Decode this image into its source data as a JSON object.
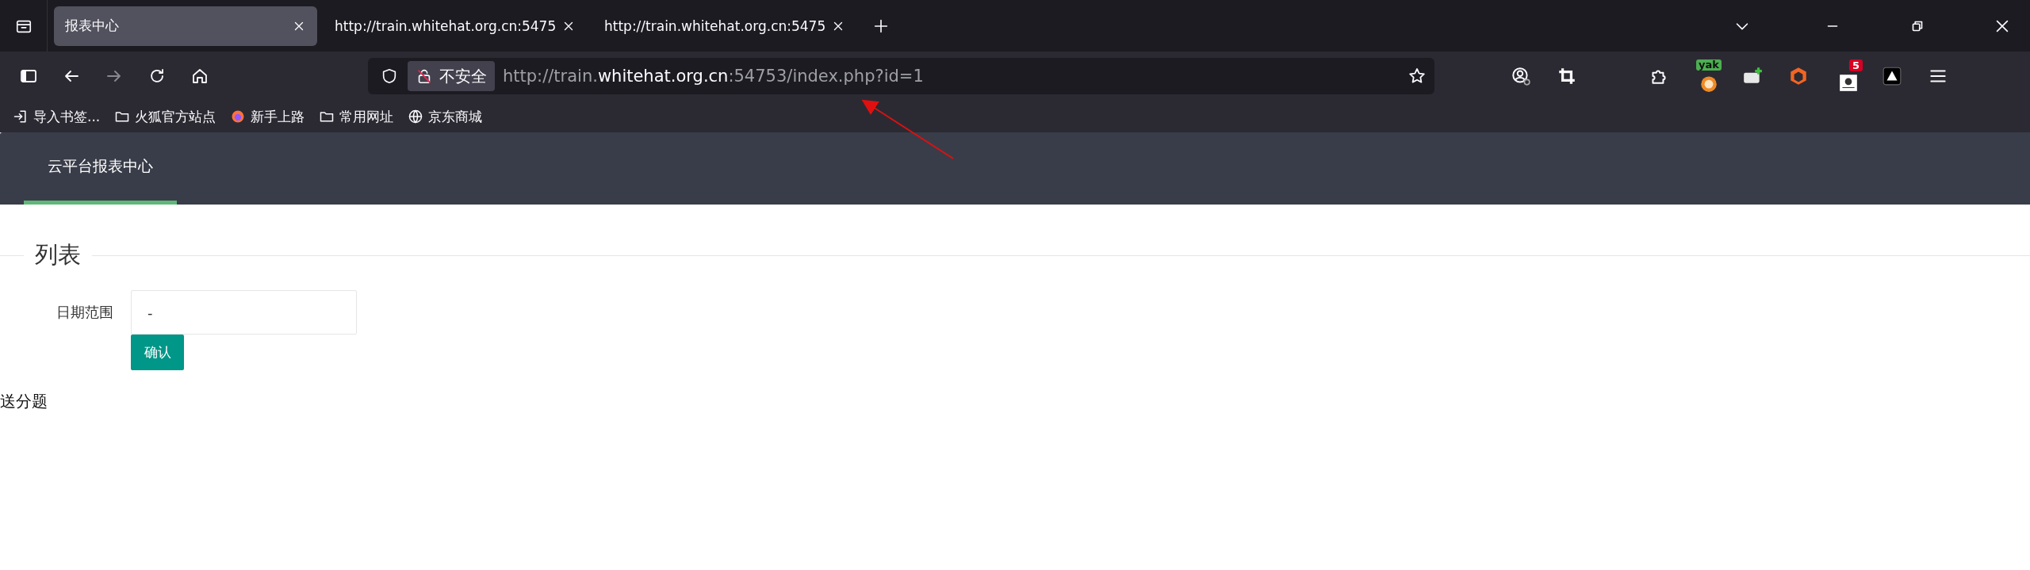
{
  "browser": {
    "tabs": [
      {
        "title": "报表中心",
        "selected": true
      },
      {
        "title": "http://train.whitehat.org.cn:5475",
        "selected": false
      },
      {
        "title": "http://train.whitehat.org.cn:5475",
        "selected": false
      }
    ],
    "security_label": "不安全",
    "url_parts": [
      {
        "text": "http://train.",
        "emphasized": false
      },
      {
        "text": "whitehat.org.cn",
        "emphasized": true
      },
      {
        "text": ":54753/index.php?id=1",
        "emphasized": false
      }
    ],
    "extension_tag": "yak",
    "notification_count": "5",
    "bookmarks": [
      {
        "label": "导入书签...",
        "kind": "import"
      },
      {
        "label": "火狐官方站点",
        "kind": "folder"
      },
      {
        "label": "新手上路",
        "kind": "firefox"
      },
      {
        "label": "常用网址",
        "kind": "folder"
      },
      {
        "label": "京东商城",
        "kind": "globe"
      }
    ]
  },
  "page": {
    "nav": [
      {
        "label": "云平台报表中心",
        "selected": true
      }
    ],
    "section_title": "列表",
    "form": {
      "label": "日期范围",
      "value": "-",
      "button": "确认"
    },
    "footer_text": "送分题"
  }
}
